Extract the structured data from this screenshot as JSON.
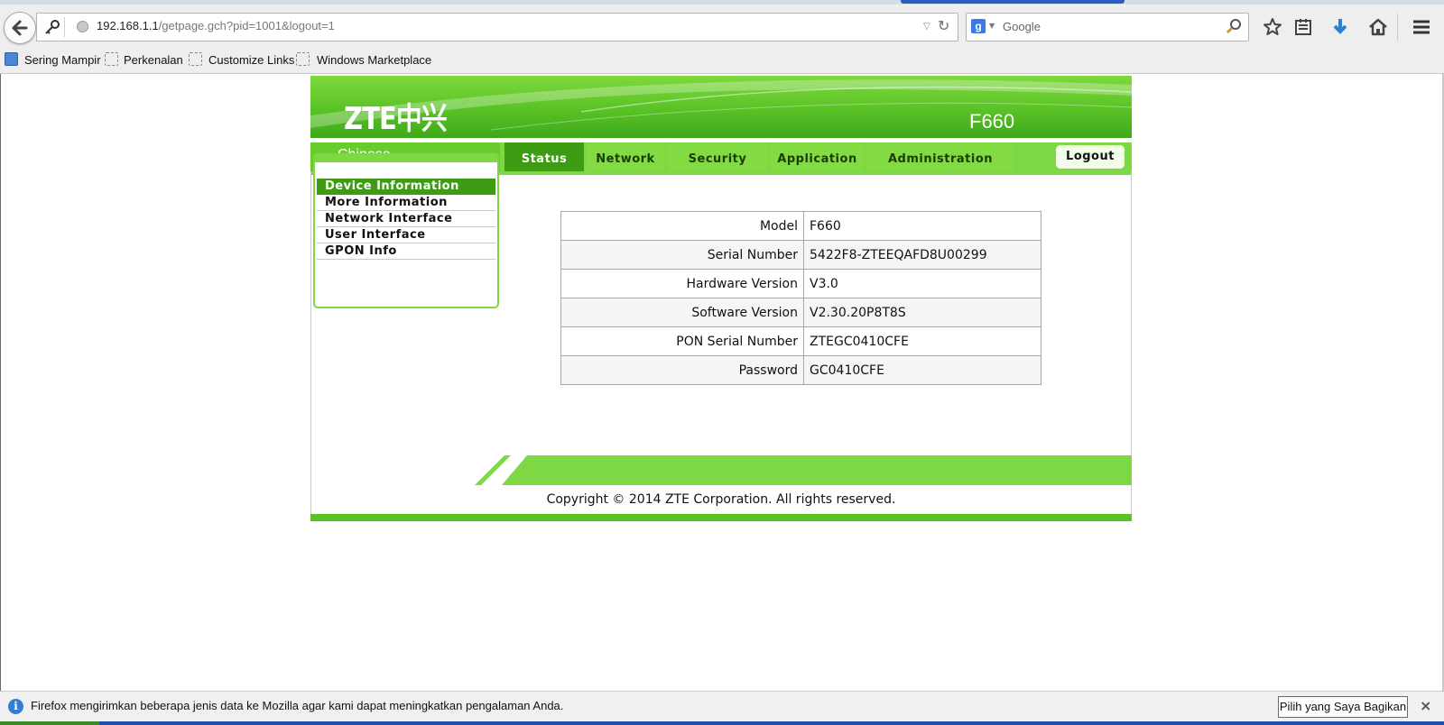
{
  "browser": {
    "url_host": "192.168.1.1",
    "url_path": "/getpage.gch?pid=1001&logout=1",
    "search_placeholder": "Google",
    "search_engine_glyph": "g",
    "bookmarks": [
      {
        "label": "Sering Mampir",
        "icon": "bookmark-page-icon"
      },
      {
        "label": "Perkenalan",
        "icon": "dashed-page-icon"
      },
      {
        "label": "Customize Links",
        "icon": "dashed-page-icon"
      },
      {
        "label": "Windows Marketplace",
        "icon": "dashed-page-icon"
      }
    ],
    "toolbar_icons": [
      "back-arrow-icon",
      "key-icon",
      "globe-icon",
      "dropdown-arrow-icon",
      "reload-icon",
      "magnifier-icon",
      "star-icon",
      "reading-list-icon",
      "download-icon",
      "home-icon",
      "hamburger-menu-icon"
    ]
  },
  "router": {
    "brand": "ZTE中兴",
    "model": "F660",
    "language_link": "Chinese",
    "tabs": [
      {
        "label": "Status",
        "active": true
      },
      {
        "label": "Network",
        "active": false
      },
      {
        "label": "Security",
        "active": false
      },
      {
        "label": "Application",
        "active": false
      },
      {
        "label": "Administration",
        "active": false
      }
    ],
    "logout_label": "Logout",
    "sidebar": [
      {
        "label": "Device Information",
        "active": true
      },
      {
        "label": "More Information",
        "active": false
      },
      {
        "label": "Network Interface",
        "active": false
      },
      {
        "label": "User Interface",
        "active": false
      },
      {
        "label": "GPON Info",
        "active": false
      }
    ],
    "device_info": [
      {
        "key": "Model",
        "value": "F660"
      },
      {
        "key": "Serial Number",
        "value": "5422F8-ZTEEQAFD8U00299"
      },
      {
        "key": "Hardware Version",
        "value": "V3.0"
      },
      {
        "key": "Software Version",
        "value": "V2.30.20P8T8S"
      },
      {
        "key": "PON Serial Number",
        "value": "ZTEGC0410CFE"
      },
      {
        "key": "Password",
        "value": "GC0410CFE"
      }
    ],
    "copyright": "Copyright © 2014 ZTE Corporation. All rights reserved.",
    "colors": {
      "primary_green": "#3d9c14",
      "light_green": "#7ed844"
    }
  },
  "notification": {
    "message": "Firefox mengirimkan beberapa jenis data ke Mozilla agar kami dapat meningkatkan pengalaman Anda.",
    "button_label": "Pilih yang Saya Bagikan",
    "info_glyph": "i",
    "close_glyph": "×"
  }
}
